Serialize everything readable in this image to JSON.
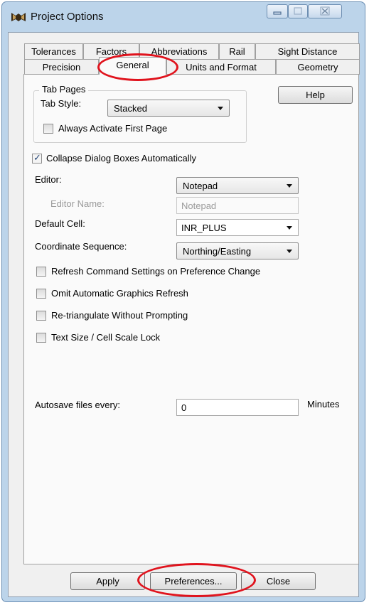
{
  "window": {
    "title": "Project Options",
    "controls": {
      "minimize_icon": "minimize-icon",
      "maximize_icon": "maximize-icon",
      "close_icon": "close-icon",
      "close_glyph": "☒"
    }
  },
  "tabs": {
    "row_back": [
      "Tolerances",
      "Factors",
      "Abbreviations",
      "Rail",
      "Sight Distance"
    ],
    "row_front": [
      "Precision",
      "General",
      "Units and Format",
      "Geometry"
    ],
    "selected": "General"
  },
  "tab_pages": {
    "group_label": "Tab Pages",
    "tab_style_label": "Tab Style:",
    "tab_style_value": "Stacked",
    "always_activate_label": "Always Activate First Page",
    "always_activate_checked": false,
    "help_label": "Help"
  },
  "general": {
    "collapse_label": "Collapse Dialog Boxes Automatically",
    "collapse_checked": true,
    "editor_label": "Editor:",
    "editor_value": "Notepad",
    "editor_name_label": "Editor Name:",
    "editor_name_value": "Notepad",
    "default_cell_label": "Default Cell:",
    "default_cell_value": "INR_PLUS",
    "coord_seq_label": "Coordinate Sequence:",
    "coord_seq_value": "Northing/Easting",
    "refresh_label": "Refresh Command Settings on Preference Change",
    "refresh_checked": false,
    "omit_label": "Omit Automatic Graphics Refresh",
    "omit_checked": false,
    "retriangulate_label": "Re-triangulate Without Prompting",
    "retriangulate_checked": false,
    "textsize_label": "Text Size / Cell Scale Lock",
    "textsize_checked": false,
    "autosave_label": "Autosave files every:",
    "autosave_value": "0",
    "autosave_unit": "Minutes"
  },
  "buttons": {
    "apply": "Apply",
    "preferences": "Preferences...",
    "close": "Close"
  },
  "colors": {
    "highlight": "#e0131d",
    "window_frame": "#bcd4ea"
  }
}
